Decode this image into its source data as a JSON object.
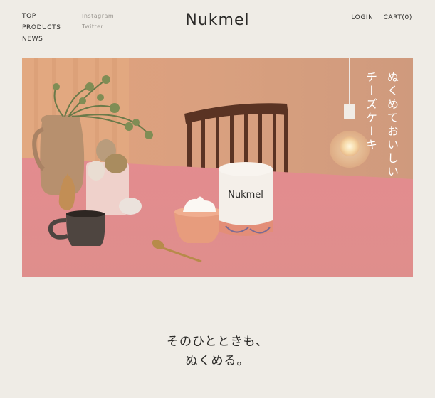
{
  "nav": {
    "main": [
      "TOP",
      "PRODUCTS",
      "NEWS"
    ],
    "social": [
      "Instagram",
      "Twitter"
    ],
    "logo": "Nukmel",
    "login": "LOGIN",
    "cart": "CART(0)"
  },
  "hero": {
    "tagline_col1": "ぬくめておいしい",
    "tagline_col2": "チーズケーキ",
    "package_brand": "Nukmel"
  },
  "main": {
    "tagline_line1": "そのひとときも、",
    "tagline_line2": "ぬくめる。"
  },
  "colors": {
    "background": "#efece6",
    "text": "#2b2a28",
    "wall": "#dc9f7e",
    "table": "#e08a8c"
  }
}
